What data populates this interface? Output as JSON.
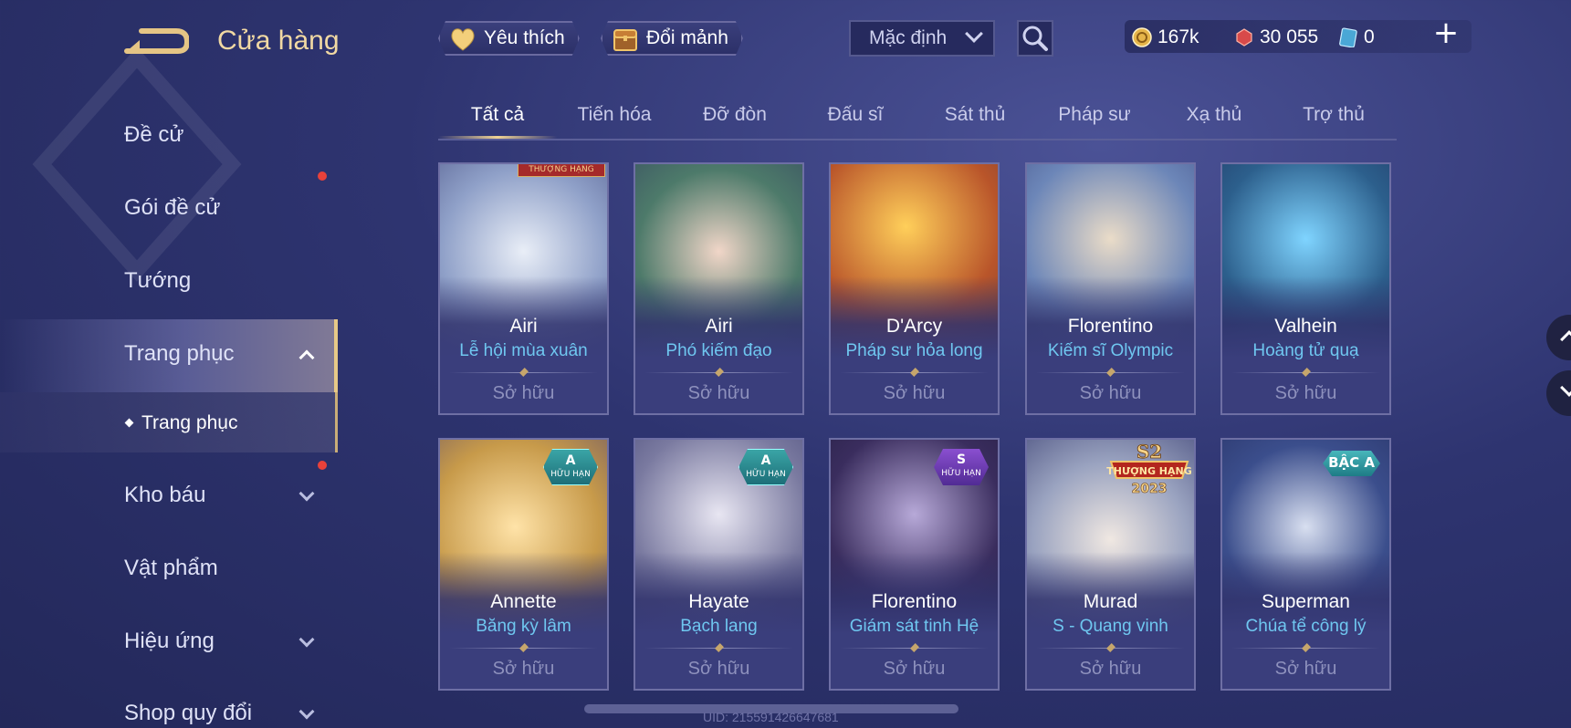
{
  "header": {
    "title": "Cửa hàng",
    "favorites_label": "Yêu thích",
    "exchange_label": "Đổi mảnh",
    "sort_value": "Mặc định"
  },
  "currency": {
    "gold": "167k",
    "vouchers": "30 055",
    "cards": "0"
  },
  "sidebar": {
    "items": [
      {
        "label": "Đề cử"
      },
      {
        "label": "Gói đề cử"
      },
      {
        "label": "Tướng"
      },
      {
        "label": "Trang phục"
      },
      {
        "label": "Kho báu"
      },
      {
        "label": "Vật phẩm"
      },
      {
        "label": "Hiệu ứng"
      },
      {
        "label": "Shop quy đổi"
      }
    ],
    "sub_item": "Trang phục"
  },
  "tabs": [
    "Tất cả",
    "Tiến hóa",
    "Đỡ đòn",
    "Đấu sĩ",
    "Sát thủ",
    "Pháp sư",
    "Xạ thủ",
    "Trợ thủ"
  ],
  "cards": [
    {
      "hero": "Airi",
      "skin": "Lễ hội mùa xuân",
      "status": "Sở hữu",
      "badge": "",
      "badge_sub": "",
      "art_color": "#8fa0c8"
    },
    {
      "hero": "Airi",
      "skin": "Phó kiếm đạo",
      "status": "Sở hữu",
      "badge": "",
      "badge_sub": "",
      "art_color": "#4d7a6a"
    },
    {
      "hero": "D'Arcy",
      "skin": "Pháp sư hỏa long",
      "status": "Sở hữu",
      "badge": "",
      "badge_sub": "",
      "art_color": "#b9552a"
    },
    {
      "hero": "Florentino",
      "skin": "Kiếm sĩ Olympic",
      "status": "Sở hữu",
      "badge": "",
      "badge_sub": "",
      "art_color": "#6c86b8"
    },
    {
      "hero": "Valhein",
      "skin": "Hoàng tử quạ",
      "status": "Sở hữu",
      "badge": "",
      "badge_sub": "",
      "art_color": "#2c5f8c"
    },
    {
      "hero": "Annette",
      "skin": "Băng kỳ lâm",
      "status": "Sở hữu",
      "badge": "A",
      "badge_sub": "HỮU HẠN",
      "art_color": "#c79a4a"
    },
    {
      "hero": "Hayate",
      "skin": "Bạch lang",
      "status": "Sở hữu",
      "badge": "A",
      "badge_sub": "HỮU HẠN",
      "art_color": "#7a7aa0"
    },
    {
      "hero": "Florentino",
      "skin": "Giám sát tinh Hệ",
      "status": "Sở hữu",
      "badge": "S",
      "badge_sub": "HỮU HẠN",
      "art_color": "#3a2d5e"
    },
    {
      "hero": "Murad",
      "skin": "S - Quang vinh",
      "status": "Sở hữu",
      "badge": "",
      "badge_sub": "",
      "art_color": "#9aa3c0"
    },
    {
      "hero": "Superman",
      "skin": "Chúa tể công lý",
      "status": "Sở hữu",
      "badge": "BẬC A",
      "badge_sub": "",
      "art_color": "#3b4e8c"
    }
  ],
  "rank_emblem": {
    "season": "S2",
    "label": "THƯỢNG HẠNG",
    "year": "2023"
  },
  "uid": "UID: 215591426647681",
  "colors": {
    "accent_gold": "#f1d9a3",
    "skin_name": "#6fc7f0",
    "notification": "#e8413a"
  }
}
